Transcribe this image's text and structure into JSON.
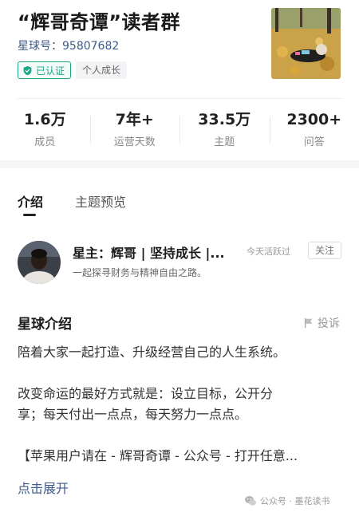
{
  "header": {
    "title": "“辉哥奇谭”读者群",
    "planet_id": "星球号：95807682",
    "verified_label": "已认证",
    "category_tag": "个人成长"
  },
  "stats": [
    {
      "value": "1.6万",
      "label": "成员"
    },
    {
      "value": "7年+",
      "label": "运营天数"
    },
    {
      "value": "33.5万",
      "label": "主题"
    },
    {
      "value": "2300+",
      "label": "问答"
    }
  ],
  "tabs": {
    "intro": "介绍",
    "preview": "主题预览"
  },
  "owner": {
    "name": "星主：辉哥 | 坚持成长 |...",
    "active": "今天活跃过",
    "follow": "关注",
    "desc": "一起探寻财务与精神自由之路。"
  },
  "intro": {
    "title": "星球介绍",
    "report": "投诉",
    "lines": [
      "陪着大家一起打造、升级经营自己的人生系统。",
      "改变命运的最好方式就是：设立目标，公开分",
      "享；每天付出一点点，每天努力一点点。",
      "【苹果用户请在 - 辉哥奇谭 - 公众号 - 打开任意..."
    ],
    "expand": "点击展开"
  },
  "watermark": {
    "text": "公众号 · 墨花读书"
  },
  "colors": {
    "accent_green": "#1aa886",
    "link_blue": "#3d5a8a"
  }
}
